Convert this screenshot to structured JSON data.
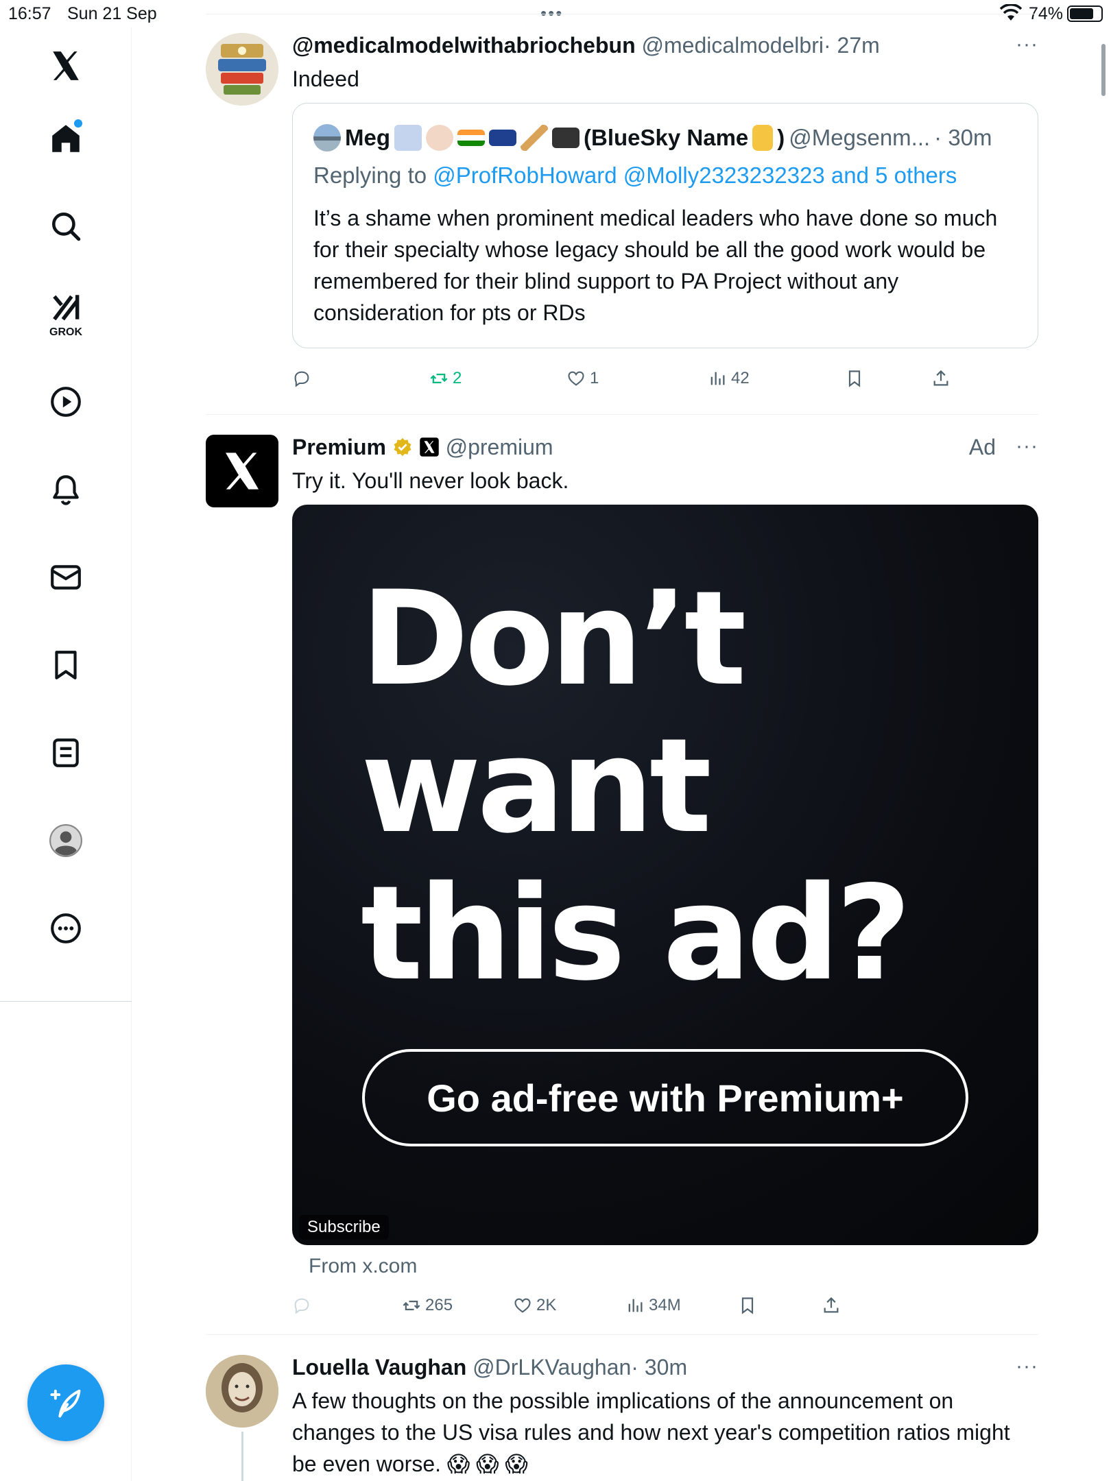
{
  "status_bar": {
    "time": "16:57",
    "date": "Sun 21 Sep",
    "battery": "74%"
  },
  "sidebar": {
    "grok_label": "GROK",
    "items": [
      {
        "name": "x-logo-icon"
      },
      {
        "name": "home-icon"
      },
      {
        "name": "search-icon"
      },
      {
        "name": "grok-icon"
      },
      {
        "name": "video-icon"
      },
      {
        "name": "notifications-icon"
      },
      {
        "name": "messages-icon"
      },
      {
        "name": "bookmarks-icon"
      },
      {
        "name": "lists-icon"
      },
      {
        "name": "profile-icon"
      },
      {
        "name": "more-icon"
      }
    ],
    "accent_color": "#1d9bf0"
  },
  "tweets": {
    "t1": {
      "name": "@medicalmodelwithabriochebun",
      "handle": "@medicalmodelbri",
      "time": "· 27m",
      "text": "Indeed",
      "quote": {
        "name": "Meg",
        "name_suffix": "(BlueSky Name",
        "name_close": ")",
        "handle": "@Megsenm...",
        "time": "· 30m",
        "reply_prefix": "Replying to",
        "reply_users": "@ProfRobHoward @Molly2323232323 and 5 others",
        "text": "It’s a shame when prominent medical leaders who have done so much for their specialty whose legacy should be all the good work would be remembered for their blind support to PA Project without any consideration for pts or RDs"
      },
      "actions": {
        "retweets": "2",
        "likes": "1",
        "views": "42"
      }
    },
    "t2": {
      "name": "Premium",
      "handle": "@premium",
      "ad_label": "Ad",
      "text": "Try it. You'll never look back.",
      "ad_headline_1": "Don’t",
      "ad_headline_2": "want",
      "ad_headline_3": "this ad?",
      "ad_cta": "Go ad-free with Premium+",
      "ad_subscribe": "Subscribe",
      "from": "From x.com",
      "actions": {
        "retweets": "265",
        "likes": "2K",
        "views": "34M"
      }
    },
    "t3": {
      "name": "Louella Vaughan",
      "handle": "@DrLKVaughan",
      "time": "· 30m",
      "text": "A few thoughts on the possible implications of the announcement on changes to the US visa rules and how next year's competition ratios might be even worse. 😱 😱 😱"
    }
  },
  "more_glyph": "···"
}
